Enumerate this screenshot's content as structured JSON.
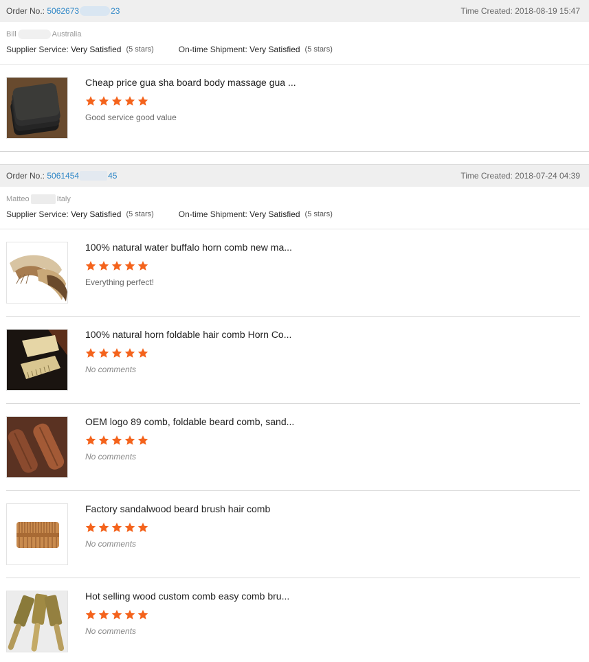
{
  "orders": [
    {
      "order_label": "Order No.:",
      "order_prefix": "5062673",
      "order_suffix": "23",
      "time_label": "Time Created:",
      "time": "2018-08-19 15:47",
      "buyer_first": "Bill",
      "buyer_country": "Australia",
      "supplier_label": "Supplier Service:",
      "supplier_value": "Very Satisfied",
      "supplier_stars": "(5 stars)",
      "shipment_label": "On-time Shipment:",
      "shipment_value": "Very Satisfied",
      "shipment_stars": "(5 stars)",
      "items": [
        {
          "name": "Cheap price gua sha board body massage gua ...",
          "rating": 5,
          "comment": "Good service good value",
          "thumb": "black-gua-sha-boards"
        }
      ]
    },
    {
      "order_label": "Order No.:",
      "order_prefix": "5061454",
      "order_suffix": "45",
      "time_label": "Time Created:",
      "time": "2018-07-24 04:39",
      "buyer_first": "Matteo",
      "buyer_country": "Italy",
      "supplier_label": "Supplier Service:",
      "supplier_value": "Very Satisfied",
      "supplier_stars": "(5 stars)",
      "shipment_label": "On-time Shipment:",
      "shipment_value": "Very Satisfied",
      "shipment_stars": "(5 stars)",
      "items": [
        {
          "name": "100% natural water buffalo horn comb new ma...",
          "rating": 5,
          "comment": "Everything perfect!",
          "thumb": "horn-combs"
        },
        {
          "name": "100% natural horn foldable hair comb Horn Co...",
          "rating": 5,
          "comment": "No comments",
          "thumb": "foldable-horn-comb"
        },
        {
          "name": "OEM logo 89 comb, foldable beard comb, sand...",
          "rating": 5,
          "comment": "No comments",
          "thumb": "sandalwood-folding-combs"
        },
        {
          "name": "Factory sandalwood beard brush hair comb",
          "rating": 5,
          "comment": "No comments",
          "thumb": "sandalwood-beard-comb"
        },
        {
          "name": "Hot selling wood custom comb easy comb bru...",
          "rating": 5,
          "comment": "No comments",
          "thumb": "wood-handle-combs"
        }
      ]
    }
  ],
  "colors": {
    "star": "#f4631c",
    "link": "#2f87c7",
    "header_bg": "#efefef"
  },
  "icons": {
    "star": "star-icon"
  }
}
